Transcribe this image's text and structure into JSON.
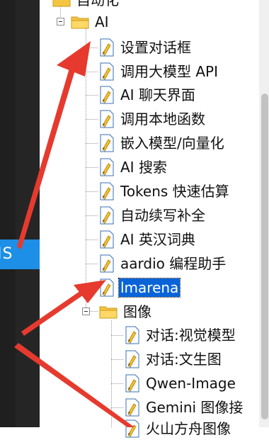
{
  "tree": {
    "top_folder_label": "自动化",
    "ai_folder_label": "AI",
    "ai_children": [
      "设置对话框",
      "调用大模型 API",
      "AI 聊天界面",
      "调用本地函数",
      "嵌入模型/向量化",
      "AI 搜索",
      "Tokens 快速估算",
      "自动续写补全",
      "AI 英汉词典",
      "aardio 编程助手",
      "lmarena"
    ],
    "image_folder_label": "图像",
    "image_children": [
      "对话:视觉模型",
      "对话:文生图",
      "Qwen-Image",
      "Gemini 图像接",
      "火山方舟图像"
    ],
    "selected_item": "lmarena"
  },
  "left_panel": {
    "visible_text": "IS"
  },
  "colors": {
    "selection": "#0a64d8",
    "arrow": "#e63a2e",
    "folder": "#f5c542"
  }
}
